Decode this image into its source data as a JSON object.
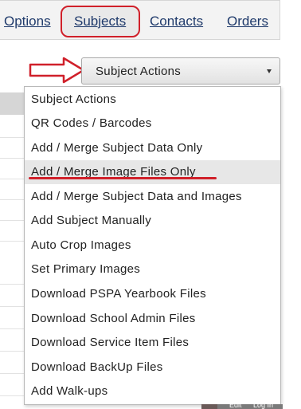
{
  "nav": {
    "items": [
      {
        "label": "Options"
      },
      {
        "label": "Subjects"
      },
      {
        "label": "Contacts"
      },
      {
        "label": "Orders"
      }
    ]
  },
  "dropdown": {
    "selected_label": "Subject Actions",
    "items": [
      {
        "label": "Subject Actions"
      },
      {
        "label": "QR Codes / Barcodes"
      },
      {
        "label": "Add / Merge Subject Data Only"
      },
      {
        "label": "Add / Merge Image Files Only"
      },
      {
        "label": "Add / Merge Subject Data and Images"
      },
      {
        "label": "Add Subject Manually"
      },
      {
        "label": "Auto Crop Images"
      },
      {
        "label": "Set Primary Images"
      },
      {
        "label": "Download PSPA Yearbook Files"
      },
      {
        "label": "Download School Admin Files"
      },
      {
        "label": "Download Service Item Files"
      },
      {
        "label": "Download BackUp Files"
      },
      {
        "label": "Add Walk-ups"
      }
    ],
    "highlighted_index": 3
  },
  "footer_partial": {
    "edit_label": "Edit",
    "login_label": "Log In"
  },
  "colors": {
    "annotation_red": "#d0202a",
    "link": "#1f3a6b",
    "highlight_bg": "#e7e7e7"
  }
}
